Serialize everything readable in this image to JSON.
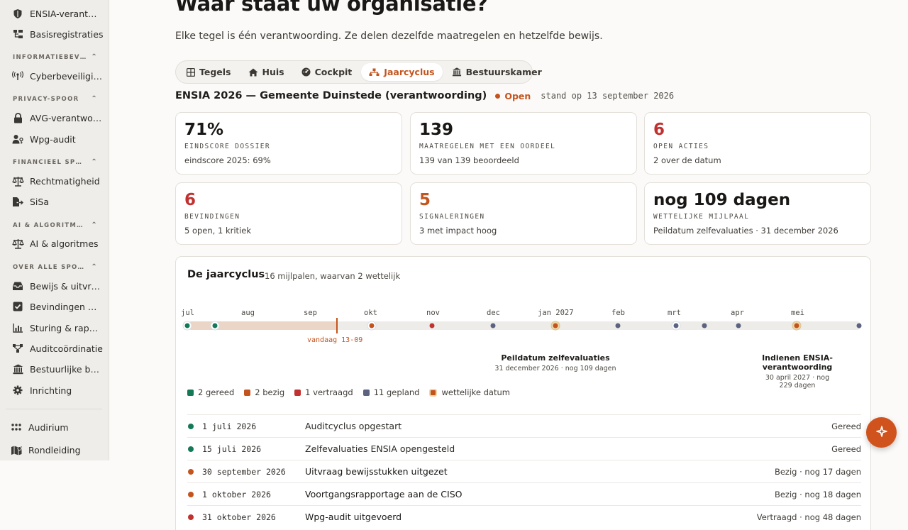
{
  "sidebar": {
    "items_top": [
      {
        "label": "ENSIA-verantwoording",
        "icon": "shield-icon"
      },
      {
        "label": "Basisregistraties",
        "icon": "hierarchy-icon"
      }
    ],
    "sections": [
      {
        "title": "INFORMATIEBEVEILIGING",
        "items": [
          {
            "label": "Cyberbeveiliging",
            "icon": "antenna-icon"
          }
        ]
      },
      {
        "title": "PRIVACY-SPOOR",
        "items": [
          {
            "label": "AVG-verantwoording",
            "icon": "lock-icon"
          },
          {
            "label": "Wpg-audit",
            "icon": "user-key-icon"
          }
        ]
      },
      {
        "title": "FINANCIEEL SPOOR",
        "items": [
          {
            "label": "Rechtmatigheid",
            "icon": "scales-icon"
          },
          {
            "label": "SiSa",
            "icon": "file-export-icon"
          }
        ]
      },
      {
        "title": "AI & ALGORITMES",
        "items": [
          {
            "label": "AI & algoritmes",
            "icon": "scales-icon"
          }
        ]
      },
      {
        "title": "OVER ALLE SPOREN",
        "items": [
          {
            "label": "Bewijs & uitvraag",
            "icon": "inbox-icon"
          },
          {
            "label": "Bevindingen & acties",
            "icon": "checkbox-icon"
          },
          {
            "label": "Sturing & rapportage",
            "icon": "bar-chart-icon"
          },
          {
            "label": "Auditcoördinatie",
            "icon": "network-icon"
          },
          {
            "label": "Bestuurlijke boordtabel",
            "icon": "bank-icon"
          },
          {
            "label": "Inrichting",
            "icon": "gear-icon"
          }
        ]
      }
    ],
    "bottom": [
      {
        "label": "Audirium",
        "icon": "grid-icon"
      },
      {
        "label": "Rondleiding",
        "icon": "map-icon"
      }
    ]
  },
  "header": {
    "title": "Waar staat uw organisatie?",
    "subtitle": "Elke tegel is één verantwoording. Ze delen dezelfde maatregelen en hetzelfde bewijs."
  },
  "tabs": [
    {
      "label": "Tegels",
      "icon": "grid-icon"
    },
    {
      "label": "Huis",
      "icon": "home-icon"
    },
    {
      "label": "Cockpit",
      "icon": "gauge-icon"
    },
    {
      "label": "Jaarcyclus",
      "icon": "cycle-icon"
    },
    {
      "label": "Bestuurskamer",
      "icon": "bank-icon"
    }
  ],
  "active_tab": "Jaarcyclus",
  "context": {
    "org": "ENSIA 2026 — Gemeente Duinstede (verantwoording)",
    "status": "Open",
    "stand": "stand op 13 september 2026"
  },
  "cards": [
    {
      "value": "71%",
      "label": "EINDSCORE DOSSIER",
      "note": "eindscore 2025: 69%"
    },
    {
      "value": "139",
      "label": "MAATREGELEN MET EEN OORDEEL",
      "note": "139 van 139 beoordeeld"
    },
    {
      "value": "6",
      "label": "OPEN ACTIES",
      "note": "2 over de datum"
    },
    {
      "value": "6",
      "label": "BEVINDINGEN",
      "note": "5 open, 1 kritiek"
    },
    {
      "value": "5",
      "label": "SIGNALERINGEN",
      "note": "3 met impact hoog"
    },
    {
      "value": "nog 109 dagen",
      "label": "WETTELIJKE MIJLPAAL",
      "note": "Peildatum zelfevaluaties · 31 december 2026"
    }
  ],
  "colors": {
    "accent": "#c4541d",
    "green": "#137a55",
    "red": "#c0312f",
    "grey": "#5b6380"
  },
  "cycle": {
    "title": "De jaarcyclus",
    "subtitle": "16 mijlpalen, waarvan 2 wettelijk",
    "months": [
      "jul",
      "aug",
      "sep",
      "okt",
      "nov",
      "dec",
      "jan 2027",
      "feb",
      "mrt",
      "apr",
      "mei"
    ],
    "today": "vandaag 13-09",
    "milestones": [
      {
        "title": "Peildatum zelfevaluaties",
        "meta": "31 december 2026 · nog 109 dagen"
      },
      {
        "title": "Indienen ENSIA-verantwoording",
        "meta": "30 april 2027 · nog 229 dagen"
      }
    ],
    "legend": [
      {
        "label": "2 gereed",
        "color": "#137a55"
      },
      {
        "label": "2 bezig",
        "color": "#c4541d"
      },
      {
        "label": "1 vertraagd",
        "color": "#c0312f"
      },
      {
        "label": "11 gepland",
        "color": "#5b6380"
      },
      {
        "label": "wettelijke datum",
        "color": "#c4541d"
      }
    ],
    "rows": [
      {
        "date": "1 juli 2026",
        "title": "Auditcyclus opgestart",
        "state": "Gereed",
        "status": "green"
      },
      {
        "date": "15 juli 2026",
        "title": "Zelfevaluaties ENSIA opengesteld",
        "state": "Gereed",
        "status": "green"
      },
      {
        "date": "30 september 2026",
        "title": "Uitvraag bewijsstukken uitgezet",
        "state": "Bezig · nog 17 dagen",
        "status": "orange"
      },
      {
        "date": "1 oktober 2026",
        "title": "Voortgangsrapportage aan de CISO",
        "state": "Bezig · nog 18 dagen",
        "status": "orange"
      },
      {
        "date": "31 oktober 2026",
        "title": "Wpg-audit uitgevoerd",
        "state": "Vertraagd · nog 48 dagen",
        "status": "red"
      }
    ]
  }
}
